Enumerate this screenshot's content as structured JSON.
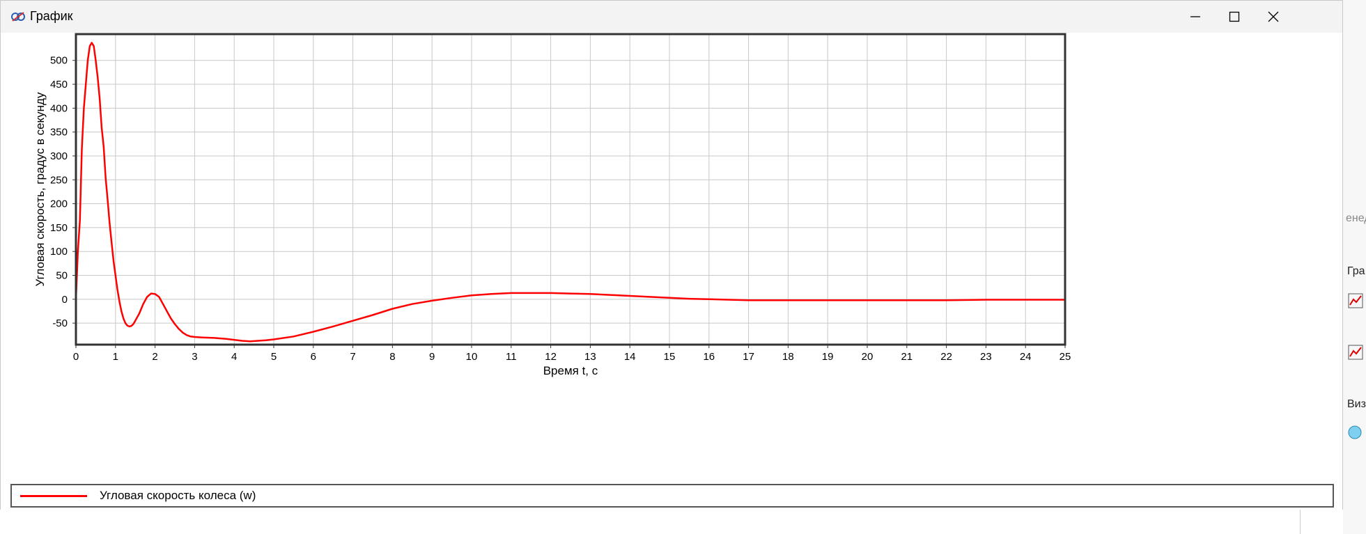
{
  "window": {
    "title": "График"
  },
  "chart_data": {
    "type": "line",
    "xlabel": "Время t, с",
    "ylabel": "Угловая скорость, градус в секунду",
    "xlim": [
      0,
      25
    ],
    "ylim": [
      -95,
      555
    ],
    "xticks": [
      0,
      1,
      2,
      3,
      4,
      5,
      6,
      7,
      8,
      9,
      10,
      11,
      12,
      13,
      14,
      15,
      16,
      17,
      18,
      19,
      20,
      21,
      22,
      23,
      24,
      25
    ],
    "yticks": [
      -50,
      0,
      50,
      100,
      150,
      200,
      250,
      300,
      350,
      400,
      450,
      500
    ],
    "grid": true,
    "legend_position": "bottom",
    "series": [
      {
        "name": "Угловая скорость колеса (w)",
        "color": "#ff0000",
        "x": [
          0,
          0.05,
          0.1,
          0.15,
          0.2,
          0.25,
          0.3,
          0.35,
          0.4,
          0.45,
          0.5,
          0.55,
          0.6,
          0.65,
          0.7,
          0.75,
          0.8,
          0.85,
          0.9,
          0.95,
          1.0,
          1.05,
          1.1,
          1.15,
          1.2,
          1.25,
          1.3,
          1.35,
          1.4,
          1.45,
          1.5,
          1.6,
          1.7,
          1.8,
          1.9,
          2.0,
          2.1,
          2.2,
          2.3,
          2.4,
          2.5,
          2.6,
          2.7,
          2.8,
          2.9,
          3.0,
          3.2,
          3.5,
          3.8,
          4.0,
          4.2,
          4.4,
          4.6,
          4.8,
          5.0,
          5.5,
          6.0,
          6.5,
          7.0,
          7.5,
          8.0,
          8.5,
          9.0,
          9.5,
          10.0,
          10.5,
          11.0,
          11.5,
          12.0,
          12.5,
          13.0,
          13.5,
          14.0,
          14.5,
          15.0,
          15.5,
          16.0,
          16.5,
          17.0,
          18.0,
          19.0,
          20.0,
          21.0,
          22.0,
          23.0,
          24.0,
          25.0
        ],
        "y": [
          0,
          100,
          165,
          315,
          400,
          450,
          500,
          530,
          537,
          530,
          500,
          465,
          420,
          360,
          320,
          255,
          210,
          160,
          120,
          80,
          50,
          20,
          -5,
          -25,
          -40,
          -50,
          -55,
          -57,
          -56,
          -52,
          -45,
          -30,
          -10,
          5,
          12,
          11,
          5,
          -10,
          -25,
          -40,
          -52,
          -62,
          -70,
          -75,
          -78,
          -79,
          -80,
          -81,
          -83,
          -85,
          -87,
          -88,
          -87,
          -86,
          -84,
          -78,
          -68,
          -57,
          -45,
          -33,
          -20,
          -10,
          -3,
          3,
          8,
          11,
          13,
          13,
          13,
          12,
          11,
          9,
          7,
          5,
          3,
          1,
          0,
          -1,
          -2,
          -2,
          -2,
          -2,
          -2,
          -2,
          -1,
          -1,
          -1
        ]
      }
    ]
  },
  "legend": {
    "label": "Угловая скорость колеса (w)"
  },
  "background_app": {
    "t1": "енед",
    "t2": "Гра",
    "t3": "Виз"
  }
}
